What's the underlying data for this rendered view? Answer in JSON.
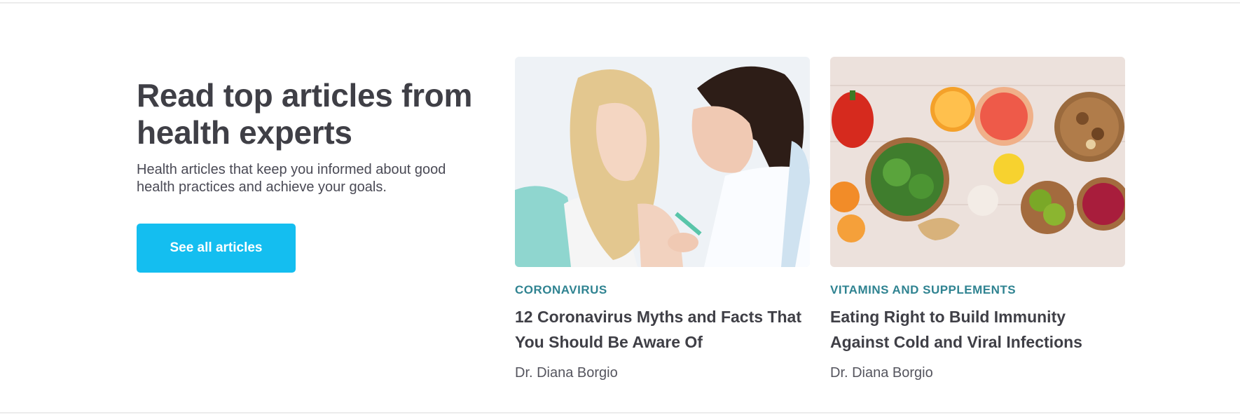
{
  "section": {
    "headline": "Read top articles from health experts",
    "subtext": "Health articles that keep you informed about good health practices and achieve your goals.",
    "cta_label": "See all articles"
  },
  "articles": [
    {
      "category": "CORONAVIRUS",
      "title": "12 Coronavirus Myths and Facts That You Should Be Aware Of",
      "author": "Dr. Diana Borgio",
      "image": "vaccination-photo"
    },
    {
      "category": "VITAMINS AND SUPPLEMENTS",
      "title": "Eating Right to Build Immunity Against Cold and Viral Infections",
      "author": "Dr. Diana Borgio",
      "image": "healthy-food-photo"
    }
  ],
  "colors": {
    "accent": "#14bef0",
    "category": "#2f8391",
    "heading": "#3f3f46"
  }
}
